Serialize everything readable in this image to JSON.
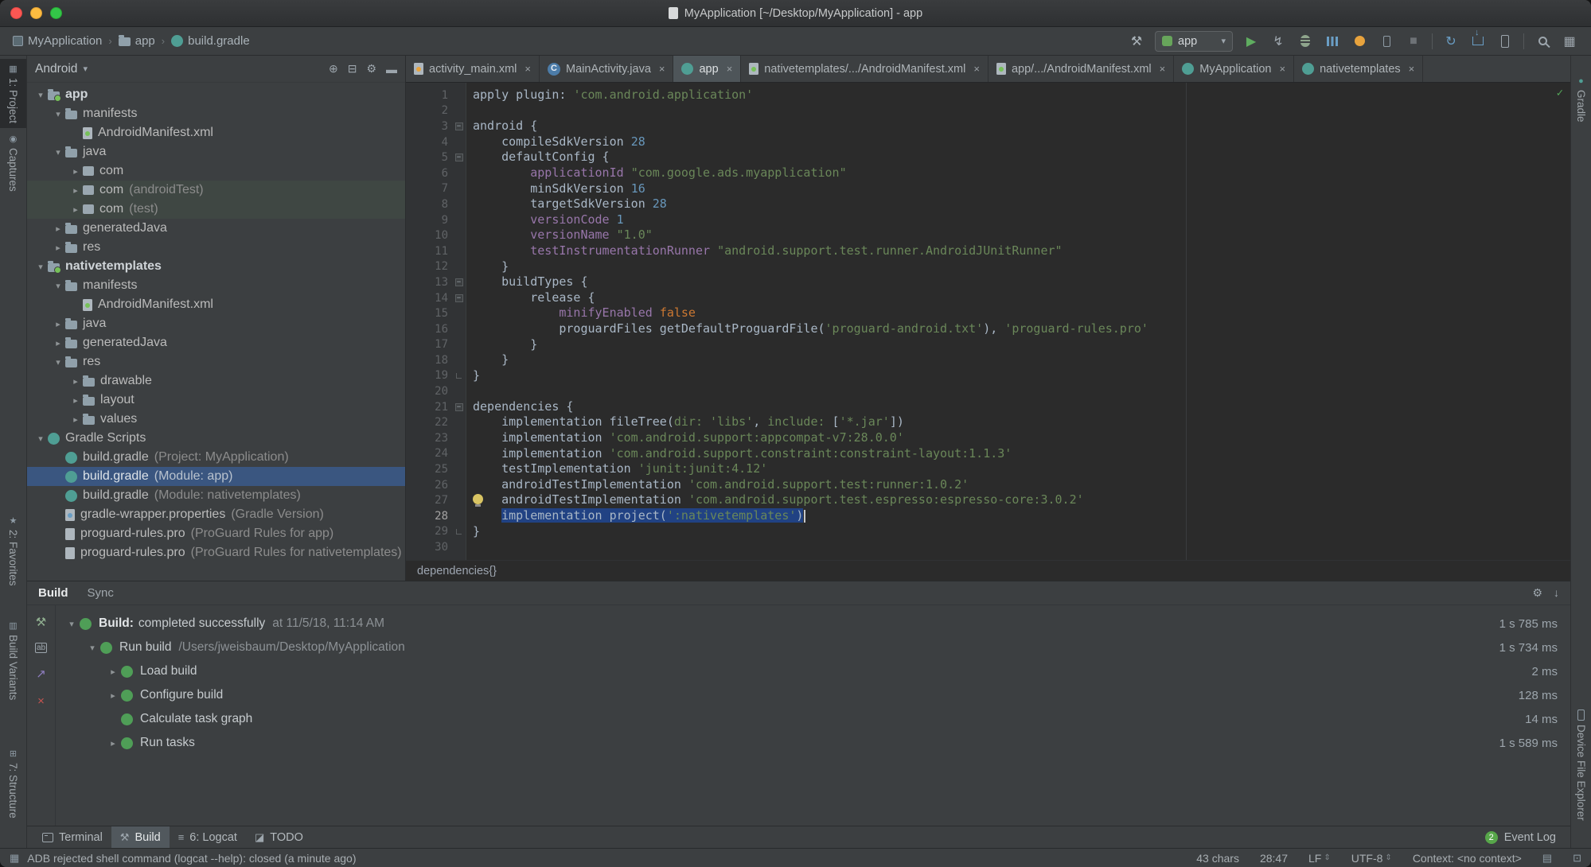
{
  "titlebar": {
    "title": "MyApplication [~/Desktop/MyApplication] - app"
  },
  "toolbar": {
    "breadcrumbs": [
      {
        "label": "MyApplication",
        "icon": "project"
      },
      {
        "label": "app",
        "icon": "folder"
      },
      {
        "label": "build.gradle",
        "icon": "gradle"
      }
    ],
    "run_config": {
      "label": "app"
    },
    "right_icons": [
      {
        "name": "build-hammer-icon",
        "type": "glyph",
        "glyph": "⚒",
        "color": "#A9B2B8"
      },
      {
        "name": "run-config-select",
        "type": "combo"
      },
      {
        "name": "run-icon",
        "type": "glyph",
        "glyph": "▶",
        "color": "#5FAD60"
      },
      {
        "name": "apply-changes-icon",
        "type": "glyph",
        "glyph": "↯",
        "color": "#9DA6AD"
      },
      {
        "name": "debug-icon",
        "type": "css",
        "cls": "i-bug"
      },
      {
        "name": "profiler-icon",
        "type": "css",
        "cls": "i-bars"
      },
      {
        "name": "firebase-assistant-icon",
        "type": "css",
        "cls": "i-dot"
      },
      {
        "name": "attach-debugger-icon",
        "type": "css",
        "cls": "i-phone-s"
      },
      {
        "name": "stop-icon",
        "type": "glyph",
        "glyph": "■",
        "color": "#6E7276"
      },
      {
        "name": "toolbar-separator",
        "type": "sep"
      },
      {
        "name": "sync-gradle-icon",
        "type": "glyph",
        "glyph": "↻",
        "color": "#6A9EC5"
      },
      {
        "name": "sdk-manager-icon",
        "type": "css",
        "cls": "i-tray"
      },
      {
        "name": "avd-manager-icon",
        "type": "css",
        "cls": "i-phone"
      },
      {
        "name": "toolbar-separator-2",
        "type": "sep"
      },
      {
        "name": "search-everywhere-icon",
        "type": "css",
        "cls": "i-search"
      },
      {
        "name": "layout-inspector-icon",
        "type": "glyph",
        "glyph": "▦",
        "color": "#9DA6AD"
      }
    ]
  },
  "left_stripe": {
    "items": [
      {
        "label": "1: Project",
        "icon_name": "project-stripe-icon",
        "glyph": "▦",
        "active": true
      },
      {
        "label": "Captures",
        "icon_name": "captures-icon",
        "glyph": "◉",
        "active": false
      },
      {
        "label": "2: Favorites",
        "icon_name": "favorites-icon",
        "glyph": "★",
        "active": false
      },
      {
        "label": "Build Variants",
        "icon_name": "build-variants-icon",
        "glyph": "▥",
        "active": false
      },
      {
        "label": "7: Structure",
        "icon_name": "structure-icon",
        "glyph": "⊞",
        "active": false
      }
    ]
  },
  "right_stripe": {
    "items": [
      {
        "label": "Gradle",
        "icon_name": "gradle-stripe-icon",
        "glyph": "●",
        "color": "#4F9E94"
      },
      {
        "label": "Device File Explorer",
        "icon_name": "device-file-explorer-icon",
        "cls": "i-phone-s"
      }
    ]
  },
  "project": {
    "header": {
      "selector": "Android"
    },
    "header_icons": [
      {
        "name": "locate-file-icon",
        "glyph": "⊕"
      },
      {
        "name": "collapse-all-icon",
        "glyph": "⊟"
      },
      {
        "name": "settings-gear-icon",
        "glyph": "⚙"
      },
      {
        "name": "hide-panel-icon",
        "glyph": "▬"
      }
    ],
    "tree": [
      {
        "depth": 0,
        "arrow": "d",
        "icon": "module",
        "label": "app",
        "bold": true
      },
      {
        "depth": 1,
        "arrow": "d",
        "icon": "folder",
        "label": "manifests"
      },
      {
        "depth": 2,
        "arrow": "",
        "icon": "manifest",
        "label": "AndroidManifest.xml"
      },
      {
        "depth": 1,
        "arrow": "d",
        "icon": "folder",
        "label": "java"
      },
      {
        "depth": 2,
        "arrow": "r",
        "icon": "package",
        "label": "com"
      },
      {
        "depth": 2,
        "arrow": "r",
        "icon": "package",
        "label": "com",
        "ann": "(androidTest)",
        "scope": "test"
      },
      {
        "depth": 2,
        "arrow": "r",
        "icon": "package",
        "label": "com",
        "ann": "(test)",
        "scope": "test"
      },
      {
        "depth": 1,
        "arrow": "r",
        "icon": "folder",
        "label": "generatedJava"
      },
      {
        "depth": 1,
        "arrow": "r",
        "icon": "folder",
        "label": "res"
      },
      {
        "depth": 0,
        "arrow": "d",
        "icon": "module",
        "label": "nativetemplates",
        "bold": true
      },
      {
        "depth": 1,
        "arrow": "d",
        "icon": "folder",
        "label": "manifests"
      },
      {
        "depth": 2,
        "arrow": "",
        "icon": "manifest",
        "label": "AndroidManifest.xml"
      },
      {
        "depth": 1,
        "arrow": "r",
        "icon": "folder",
        "label": "java"
      },
      {
        "depth": 1,
        "arrow": "r",
        "icon": "folder",
        "label": "generatedJava"
      },
      {
        "depth": 1,
        "arrow": "d",
        "icon": "folder",
        "label": "res"
      },
      {
        "depth": 2,
        "arrow": "r",
        "icon": "folder",
        "label": "drawable"
      },
      {
        "depth": 2,
        "arrow": "r",
        "icon": "folder",
        "label": "layout"
      },
      {
        "depth": 2,
        "arrow": "r",
        "icon": "folder",
        "label": "values"
      },
      {
        "depth": 0,
        "arrow": "d",
        "icon": "gradle",
        "label": "Gradle Scripts"
      },
      {
        "depth": 1,
        "arrow": "",
        "icon": "gradle",
        "label": "build.gradle",
        "ann": "(Project: MyApplication)"
      },
      {
        "depth": 1,
        "arrow": "",
        "icon": "gradle",
        "label": "build.gradle",
        "ann": "(Module: app)",
        "selected": true
      },
      {
        "depth": 1,
        "arrow": "",
        "icon": "gradle",
        "label": "build.gradle",
        "ann": "(Module: nativetemplates)"
      },
      {
        "depth": 1,
        "arrow": "",
        "icon": "properties",
        "label": "gradle-wrapper.properties",
        "ann": "(Gradle Version)"
      },
      {
        "depth": 1,
        "arrow": "",
        "icon": "file",
        "label": "proguard-rules.pro",
        "ann": "(ProGuard Rules for app)"
      },
      {
        "depth": 1,
        "arrow": "",
        "icon": "file",
        "label": "proguard-rules.pro",
        "ann": "(ProGuard Rules for nativetemplates)"
      }
    ]
  },
  "editor": {
    "tabs": [
      {
        "label": "activity_main.xml",
        "icon": "xml",
        "active": false
      },
      {
        "label": "MainActivity.java",
        "icon": "class",
        "active": false
      },
      {
        "label": "app",
        "icon": "gradle",
        "active": true
      },
      {
        "label": "nativetemplates/.../AndroidManifest.xml",
        "icon": "manifest",
        "active": false
      },
      {
        "label": "app/.../AndroidManifest.xml",
        "icon": "manifest",
        "active": false
      },
      {
        "label": "MyApplication",
        "icon": "gradle",
        "active": false
      },
      {
        "label": "nativetemplates",
        "icon": "gradle",
        "active": false
      }
    ],
    "breadcrumb": "dependencies{}",
    "code": [
      {
        "n": 1,
        "seg": [
          [
            "p",
            "apply plugin: "
          ],
          [
            "s",
            "'com.android.application'"
          ]
        ]
      },
      {
        "n": 2,
        "seg": []
      },
      {
        "n": 3,
        "fold": "s",
        "seg": [
          [
            "p",
            "android {"
          ]
        ]
      },
      {
        "n": 4,
        "seg": [
          [
            "p",
            "    compileSdkVersion "
          ],
          [
            "n",
            "28"
          ]
        ]
      },
      {
        "n": 5,
        "fold": "s",
        "seg": [
          [
            "p",
            "    defaultConfig {"
          ]
        ]
      },
      {
        "n": 6,
        "seg": [
          [
            "p",
            "        "
          ],
          [
            "f",
            "applicationId"
          ],
          [
            "p",
            " "
          ],
          [
            "s",
            "\"com.google.ads.myapplication\""
          ]
        ]
      },
      {
        "n": 7,
        "seg": [
          [
            "p",
            "        minSdkVersion "
          ],
          [
            "n",
            "16"
          ]
        ]
      },
      {
        "n": 8,
        "seg": [
          [
            "p",
            "        targetSdkVersion "
          ],
          [
            "n",
            "28"
          ]
        ]
      },
      {
        "n": 9,
        "seg": [
          [
            "p",
            "        "
          ],
          [
            "f",
            "versionCode"
          ],
          [
            "p",
            " "
          ],
          [
            "n",
            "1"
          ]
        ]
      },
      {
        "n": 10,
        "seg": [
          [
            "p",
            "        "
          ],
          [
            "f",
            "versionName"
          ],
          [
            "p",
            " "
          ],
          [
            "s",
            "\"1.0\""
          ]
        ]
      },
      {
        "n": 11,
        "seg": [
          [
            "p",
            "        "
          ],
          [
            "f",
            "testInstrumentationRunner"
          ],
          [
            "p",
            " "
          ],
          [
            "s",
            "\"android.support.test.runner.AndroidJUnitRunner\""
          ]
        ]
      },
      {
        "n": 12,
        "seg": [
          [
            "p",
            "    }"
          ]
        ]
      },
      {
        "n": 13,
        "fold": "s",
        "seg": [
          [
            "p",
            "    buildTypes {"
          ]
        ]
      },
      {
        "n": 14,
        "fold": "s",
        "seg": [
          [
            "p",
            "        release {"
          ]
        ]
      },
      {
        "n": 15,
        "seg": [
          [
            "p",
            "            "
          ],
          [
            "f",
            "minifyEnabled"
          ],
          [
            "p",
            " "
          ],
          [
            "k",
            "false"
          ]
        ]
      },
      {
        "n": 16,
        "seg": [
          [
            "p",
            "            proguardFiles getDefaultProguardFile("
          ],
          [
            "s",
            "'proguard-android.txt'"
          ],
          [
            "p",
            "), "
          ],
          [
            "s",
            "'proguard-rules.pro'"
          ]
        ]
      },
      {
        "n": 17,
        "seg": [
          [
            "p",
            "        }"
          ]
        ]
      },
      {
        "n": 18,
        "seg": [
          [
            "p",
            "    }"
          ]
        ]
      },
      {
        "n": 19,
        "fold": "e",
        "seg": [
          [
            "p",
            "}"
          ]
        ]
      },
      {
        "n": 20,
        "seg": []
      },
      {
        "n": 21,
        "fold": "s",
        "seg": [
          [
            "p",
            "dependencies {"
          ]
        ]
      },
      {
        "n": 22,
        "seg": [
          [
            "p",
            "    implementation fileTree("
          ],
          [
            "s",
            "dir:"
          ],
          [
            "p",
            " "
          ],
          [
            "s",
            "'libs'"
          ],
          [
            "p",
            ", "
          ],
          [
            "s",
            "include:"
          ],
          [
            "p",
            " ["
          ],
          [
            "s",
            "'*.jar'"
          ],
          [
            "p",
            "])"
          ]
        ]
      },
      {
        "n": 23,
        "seg": [
          [
            "p",
            "    implementation "
          ],
          [
            "s",
            "'com.android.support:appcompat-v7:28.0.0'"
          ]
        ]
      },
      {
        "n": 24,
        "seg": [
          [
            "p",
            "    implementation "
          ],
          [
            "s",
            "'com.android.support.constraint:constraint-layout:1.1.3'"
          ]
        ]
      },
      {
        "n": 25,
        "seg": [
          [
            "p",
            "    testImplementation "
          ],
          [
            "s",
            "'junit:junit:4.12'"
          ]
        ]
      },
      {
        "n": 26,
        "seg": [
          [
            "p",
            "    androidTestImplementation "
          ],
          [
            "s",
            "'com.android.support.test:runner:1.0.2'"
          ]
        ]
      },
      {
        "n": 27,
        "bulb": true,
        "seg": [
          [
            "p",
            "    androidTestImplementation "
          ],
          [
            "s",
            "'com.android.support.test.espresso:espresso-core:3.0.2'"
          ]
        ]
      },
      {
        "n": 28,
        "cur": true,
        "seg": [
          [
            "p",
            "    "
          ],
          [
            "p sel",
            "implementation project("
          ],
          [
            "s sel",
            "':nativetemplates'"
          ],
          [
            "p sel",
            ")"
          ],
          [
            "caret",
            ""
          ]
        ]
      },
      {
        "n": 29,
        "fold": "e",
        "seg": [
          [
            "p",
            "}"
          ]
        ]
      },
      {
        "n": 30,
        "seg": []
      }
    ]
  },
  "build": {
    "tabs": [
      {
        "label": "Build",
        "active": true
      },
      {
        "label": "Sync",
        "active": false
      }
    ],
    "header_icons": [
      {
        "name": "settings-gear-icon",
        "glyph": "⚙"
      },
      {
        "name": "collapse-panel-icon",
        "glyph": "↓"
      }
    ],
    "left_icons": [
      {
        "name": "rerun-build-icon",
        "glyph": "⚒",
        "color": "#8FAE8F"
      },
      {
        "name": "filter-messages-icon",
        "glyph": "ab",
        "color": "#9DA6AD",
        "boxed": true
      },
      {
        "name": "export-build-report-icon",
        "glyph": "↗",
        "color": "#8F7EC0"
      },
      {
        "name": "close-icon",
        "glyph": "×",
        "color": "#C75450"
      }
    ],
    "rows": [
      {
        "depth": 0,
        "arrow": "d",
        "title": "Build:",
        "text": "completed successfully",
        "suffix": "at 11/5/18, 11:14 AM",
        "time": "1 s 785 ms"
      },
      {
        "depth": 1,
        "arrow": "d",
        "title": "",
        "text": "Run build",
        "suffix": "/Users/jweisbaum/Desktop/MyApplication",
        "time": "1 s 734 ms"
      },
      {
        "depth": 2,
        "arrow": "r",
        "title": "",
        "text": "Load build",
        "suffix": "",
        "time": "2 ms"
      },
      {
        "depth": 2,
        "arrow": "r",
        "title": "",
        "text": "Configure build",
        "suffix": "",
        "time": "128 ms"
      },
      {
        "depth": 2,
        "arrow": "",
        "title": "",
        "text": "Calculate task graph",
        "suffix": "",
        "time": "14 ms"
      },
      {
        "depth": 2,
        "arrow": "r",
        "title": "",
        "text": "Run tasks",
        "suffix": "",
        "time": "1 s 589 ms"
      }
    ]
  },
  "bottom_bar": {
    "items": [
      {
        "label": "Terminal",
        "icon_name": "terminal-icon",
        "cls": "i-term",
        "active": false
      },
      {
        "label": "Build",
        "icon_name": "build-icon",
        "glyph": "⚒",
        "active": true
      },
      {
        "label": "6: Logcat",
        "icon_name": "logcat-icon",
        "glyph": "≡",
        "active": false
      },
      {
        "label": "TODO",
        "icon_name": "todo-icon",
        "glyph": "◪",
        "active": false
      }
    ],
    "event_log": {
      "label": "Event Log",
      "badge": "2"
    }
  },
  "status": {
    "message": "ADB rejected shell command (logcat --help): closed (a minute ago)",
    "chars": "43 chars",
    "caret": "28:47",
    "line_sep": "LF",
    "encoding": "UTF-8",
    "context": "Context: <no context>"
  }
}
